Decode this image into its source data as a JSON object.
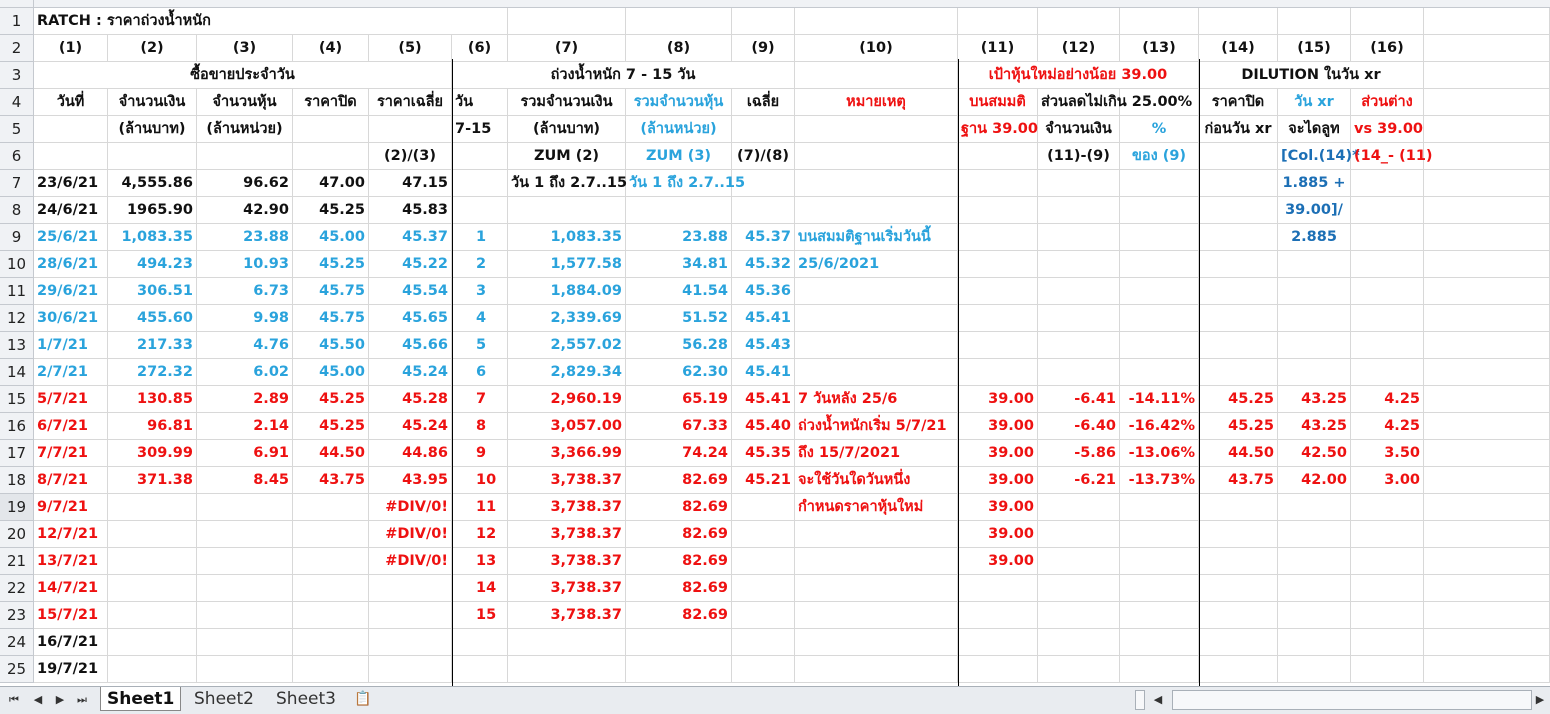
{
  "sheet_tabs": [
    "Sheet1",
    "Sheet2",
    "Sheet3"
  ],
  "active_tab": "Sheet1",
  "row_numbers": [
    "1",
    "2",
    "3",
    "4",
    "5",
    "6",
    "7",
    "8",
    "9",
    "10",
    "11",
    "12",
    "13",
    "14",
    "15",
    "16",
    "17",
    "18",
    "19",
    "20",
    "21",
    "22",
    "23",
    "24",
    "25"
  ],
  "title": "RATCH  : ราคาถ่วงน้ำหนัก",
  "col_numbers": [
    "(1)",
    "(2)",
    "(3)",
    "(4)",
    "(5)",
    "(6)",
    "(7)",
    "(8)",
    "(9)",
    "(10)",
    "(11)",
    "(12)",
    "(13)",
    "(14)",
    "(15)",
    "(16)"
  ],
  "group_headers": {
    "daily": "ซื้อขายประจำวัน",
    "weighted": "ถ่วงน้ำหนัก 7 - 15 วัน",
    "target": "เป้าหุ้นใหม่อย่างน้อย 39.00",
    "dilution": "DILUTION ในวัน xr"
  },
  "header_row4": [
    "วันที่",
    "จำนวนเงิน",
    "จำนวนหุ้น",
    "ราคาปิด",
    "ราคาเฉลี่ย",
    "วัน",
    "รวมจำนวนเงิน",
    "รวมจำนวนหุ้น",
    "เฉลี่ย",
    "หมายเหตุ",
    "บนสมมติ",
    "ส่วนลดไม่เกิน 25.00%",
    "",
    "ราคาปิด",
    "วัน xr",
    "ส่วนต่าง"
  ],
  "header_row5": [
    "",
    "(ล้านบาท)",
    "(ล้านหน่วย)",
    "",
    "",
    "7-15",
    "(ล้านบาท)",
    "(ล้านหน่วย)",
    "",
    "",
    "ฐาน 39.00",
    "จำนวนเงิน",
    "%",
    "ก่อนวัน xr",
    "จะไดลูท",
    "vs 39.00"
  ],
  "header_row6": [
    "",
    "",
    "",
    "",
    "(2)/(3)",
    "",
    "ZUM (2)",
    "ZUM (3)",
    "(7)/(8)",
    "",
    "",
    "(11)-(9)",
    "ของ (9)",
    "",
    "[Col.(14)*",
    "(14_- (11)"
  ],
  "row7_extra": {
    "g": "วัน 1 ถึง 2.7..15",
    "h": "วัน 1 ถึง 2.7..15",
    "o": "1.885 +"
  },
  "row8_extra": {
    "o": "39.00]/"
  },
  "row9_extra": {
    "o": "2.885"
  },
  "data_rows": [
    {
      "a": "23/6/21",
      "b": "4,555.86",
      "c": "96.62",
      "d": "47.00",
      "e": "47.15",
      "f": "",
      "g": "",
      "h": "",
      "i": "",
      "j": "",
      "k": "",
      "l": "",
      "m": "",
      "n": "",
      "o": "",
      "p": "",
      "color": "blk"
    },
    {
      "a": "24/6/21",
      "b": "1965.90",
      "c": "42.90",
      "d": "45.25",
      "e": "45.83",
      "f": "",
      "g": "",
      "h": "",
      "i": "",
      "j": "",
      "k": "",
      "l": "",
      "m": "",
      "n": "",
      "o": "",
      "p": "",
      "color": "blk"
    },
    {
      "a": "25/6/21",
      "b": "1,083.35",
      "c": "23.88",
      "d": "45.00",
      "e": "45.37",
      "f": "1",
      "g": "1,083.35",
      "h": "23.88",
      "i": "45.37",
      "j": "บนสมมติฐานเริ่มวันนี้",
      "k": "",
      "l": "",
      "m": "",
      "n": "",
      "o": "",
      "p": "",
      "color": "blu"
    },
    {
      "a": "28/6/21",
      "b": "494.23",
      "c": "10.93",
      "d": "45.25",
      "e": "45.22",
      "f": "2",
      "g": "1,577.58",
      "h": "34.81",
      "i": "45.32",
      "j": "25/6/2021",
      "k": "",
      "l": "",
      "m": "",
      "n": "",
      "o": "",
      "p": "",
      "color": "blu"
    },
    {
      "a": "29/6/21",
      "b": "306.51",
      "c": "6.73",
      "d": "45.75",
      "e": "45.54",
      "f": "3",
      "g": "1,884.09",
      "h": "41.54",
      "i": "45.36",
      "j": "",
      "k": "",
      "l": "",
      "m": "",
      "n": "",
      "o": "",
      "p": "",
      "color": "blu"
    },
    {
      "a": "30/6/21",
      "b": "455.60",
      "c": "9.98",
      "d": "45.75",
      "e": "45.65",
      "f": "4",
      "g": "2,339.69",
      "h": "51.52",
      "i": "45.41",
      "j": "",
      "k": "",
      "l": "",
      "m": "",
      "n": "",
      "o": "",
      "p": "",
      "color": "blu"
    },
    {
      "a": "1/7/21",
      "b": "217.33",
      "c": "4.76",
      "d": "45.50",
      "e": "45.66",
      "f": "5",
      "g": "2,557.02",
      "h": "56.28",
      "i": "45.43",
      "j": "",
      "k": "",
      "l": "",
      "m": "",
      "n": "",
      "o": "",
      "p": "",
      "color": "blu"
    },
    {
      "a": "2/7/21",
      "b": "272.32",
      "c": "6.02",
      "d": "45.00",
      "e": "45.24",
      "f": "6",
      "g": "2,829.34",
      "h": "62.30",
      "i": "45.41",
      "j": "",
      "k": "",
      "l": "",
      "m": "",
      "n": "",
      "o": "",
      "p": "",
      "color": "blu"
    },
    {
      "a": "5/7/21",
      "b": "130.85",
      "c": "2.89",
      "d": "45.25",
      "e": "45.28",
      "f": "7",
      "g": "2,960.19",
      "h": "65.19",
      "i": "45.41",
      "j": " 7  วันหลัง 25/6",
      "k": "39.00",
      "l": "-6.41",
      "m": "-14.11%",
      "n": "45.25",
      "o": "43.25",
      "p": "4.25",
      "color": "red"
    },
    {
      "a": "6/7/21",
      "b": "96.81",
      "c": "2.14",
      "d": "45.25",
      "e": "45.24",
      "f": "8",
      "g": "3,057.00",
      "h": "67.33",
      "i": "45.40",
      "j": "ถ่วงน้ำหนักเริ่ม 5/7/21",
      "k": "39.00",
      "l": "-6.40",
      "m": "-16.42%",
      "n": "45.25",
      "o": "43.25",
      "p": "4.25",
      "color": "red"
    },
    {
      "a": "7/7/21",
      "b": "309.99",
      "c": "6.91",
      "d": "44.50",
      "e": "44.86",
      "f": "9",
      "g": "3,366.99",
      "h": "74.24",
      "i": "45.35",
      "j": "ถึง 15/7/2021",
      "k": "39.00",
      "l": "-5.86",
      "m": "-13.06%",
      "n": "44.50",
      "o": "42.50",
      "p": "3.50",
      "color": "red"
    },
    {
      "a": "8/7/21",
      "b": "371.38",
      "c": "8.45",
      "d": "43.75",
      "e": "43.95",
      "f": "10",
      "g": "3,738.37",
      "h": "82.69",
      "i": "45.21",
      "j": "จะใช้วันใดวันหนึ่ง",
      "k": "39.00",
      "l": "-6.21",
      "m": "-13.73%",
      "n": "43.75",
      "o": "42.00",
      "p": "3.00",
      "color": "red"
    },
    {
      "a": "9/7/21",
      "b": "",
      "c": "",
      "d": "",
      "e": "#DIV/0!",
      "f": "11",
      "g": "3,738.37",
      "h": "82.69",
      "i": "",
      "j": "กำหนดราคาหุ้นใหม่",
      "k": "39.00",
      "l": "",
      "m": "",
      "n": "",
      "o": "",
      "p": "",
      "color": "red"
    },
    {
      "a": "12/7/21",
      "b": "",
      "c": "",
      "d": "",
      "e": "#DIV/0!",
      "f": "12",
      "g": "3,738.37",
      "h": "82.69",
      "i": "",
      "j": "",
      "k": "39.00",
      "l": "",
      "m": "",
      "n": "",
      "o": "",
      "p": "",
      "color": "red"
    },
    {
      "a": "13/7/21",
      "b": "",
      "c": "",
      "d": "",
      "e": "#DIV/0!",
      "f": "13",
      "g": "3,738.37",
      "h": "82.69",
      "i": "",
      "j": "",
      "k": "39.00",
      "l": "",
      "m": "",
      "n": "",
      "o": "",
      "p": "",
      "color": "red"
    },
    {
      "a": "14/7/21",
      "b": "",
      "c": "",
      "d": "",
      "e": "",
      "f": "14",
      "g": "3,738.37",
      "h": "82.69",
      "i": "",
      "j": "",
      "k": "",
      "l": "",
      "m": "",
      "n": "",
      "o": "",
      "p": "",
      "color": "red"
    },
    {
      "a": "15/7/21",
      "b": "",
      "c": "",
      "d": "",
      "e": "",
      "f": "15",
      "g": "3,738.37",
      "h": "82.69",
      "i": "",
      "j": "",
      "k": "",
      "l": "",
      "m": "",
      "n": "",
      "o": "",
      "p": "",
      "color": "red"
    },
    {
      "a": "16/7/21",
      "b": "",
      "c": "",
      "d": "",
      "e": "",
      "f": "",
      "g": "",
      "h": "",
      "i": "",
      "j": "",
      "k": "",
      "l": "",
      "m": "",
      "n": "",
      "o": "",
      "p": "",
      "color": "blk"
    },
    {
      "a": "19/7/21",
      "b": "",
      "c": "",
      "d": "",
      "e": "",
      "f": "",
      "g": "",
      "h": "",
      "i": "",
      "j": "",
      "k": "",
      "l": "",
      "m": "",
      "n": "",
      "o": "",
      "p": "",
      "color": "blk"
    }
  ]
}
